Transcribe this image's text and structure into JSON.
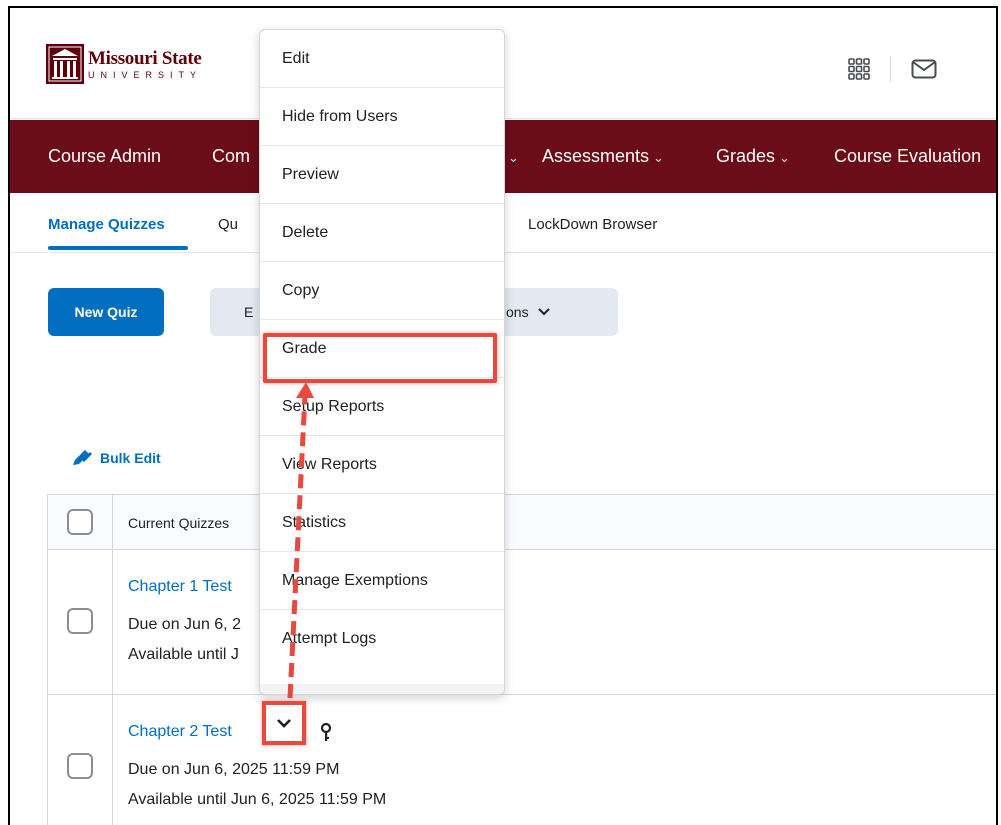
{
  "logo": {
    "brand": "Missouri State",
    "university": "UNIVERSITY"
  },
  "header": {
    "icons": [
      "apps-grid-icon",
      "mail-icon"
    ]
  },
  "nav": {
    "items": [
      {
        "label": "Course Admin"
      },
      {
        "label": "Com"
      },
      {
        "label": "Assessments"
      },
      {
        "label": "Grades"
      },
      {
        "label": "Course Evaluation"
      }
    ]
  },
  "subnav": {
    "items": [
      {
        "label": "Manage Quizzes",
        "active": true
      },
      {
        "label": "Qu"
      },
      {
        "label": "LockDown Browser"
      }
    ]
  },
  "toolbar": {
    "new_quiz": "New Quiz",
    "secondary_left": "E",
    "secondary_right": "ctions"
  },
  "bulk_edit": "Bulk Edit",
  "table": {
    "header": "Current Quizzes",
    "rows": [
      {
        "title": "Chapter 1 Test",
        "due": "Due on Jun 6, 2",
        "available": "Available until J"
      },
      {
        "title": "Chapter 2 Test",
        "due": "Due on Jun 6, 2025 11:59 PM",
        "available": "Available until Jun 6, 2025 11:59 PM"
      }
    ]
  },
  "context_menu": {
    "items": [
      "Edit",
      "Hide from Users",
      "Preview",
      "Delete",
      "Copy",
      "Grade",
      "Setup Reports",
      "View Reports",
      "Statistics",
      "Manage Exemptions",
      "Attempt Logs"
    ],
    "highlighted": "Grade"
  },
  "colors": {
    "brand": "#6a0d18",
    "accent": "#006fbf",
    "annotation": "#e8493e"
  }
}
